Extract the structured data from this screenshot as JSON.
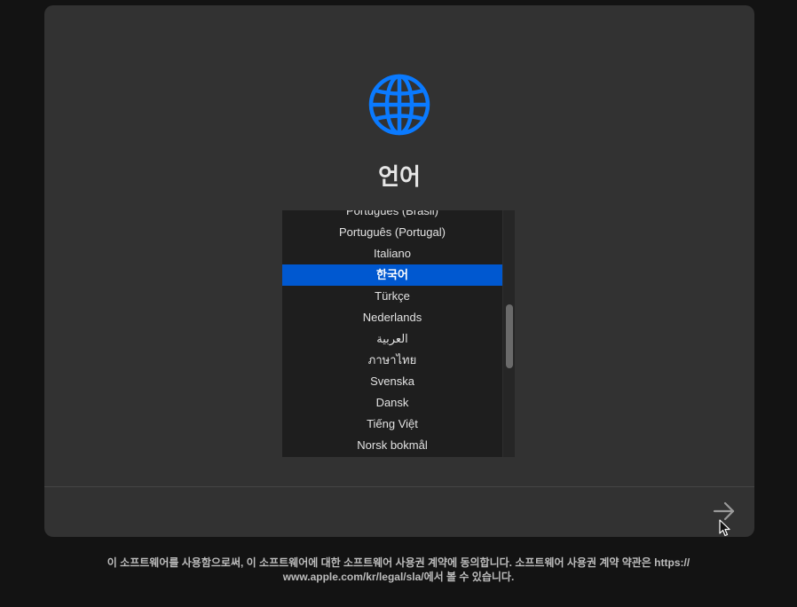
{
  "title": "언어",
  "languages": [
    {
      "label": "Português (Brasil)"
    },
    {
      "label": "Português (Portugal)"
    },
    {
      "label": "Italiano"
    },
    {
      "label": "한국어",
      "selected": true
    },
    {
      "label": "Türkçe"
    },
    {
      "label": "Nederlands"
    },
    {
      "label": "العربية"
    },
    {
      "label": "ภาษาไทย"
    },
    {
      "label": "Svenska"
    },
    {
      "label": "Dansk"
    },
    {
      "label": "Tiếng Việt"
    },
    {
      "label": "Norsk bokmål"
    }
  ],
  "icons": {
    "globe": "globe-icon",
    "next": "arrow-right-icon",
    "cursor": "mouse-pointer-icon"
  },
  "colors": {
    "accent": "#0a7aff",
    "selection": "#0058d0",
    "panel": "#323232",
    "background": "#131313"
  },
  "license": {
    "line1": "이 소프트웨어를 사용함으로써, 이 소프트웨어에 대한 소프트웨어 사용권 계약에 동의합니다. 소프트웨어 사용권 계약 약관은 https://",
    "line2": "www.apple.com/kr/legal/sla/에서 볼 수 있습니다."
  }
}
